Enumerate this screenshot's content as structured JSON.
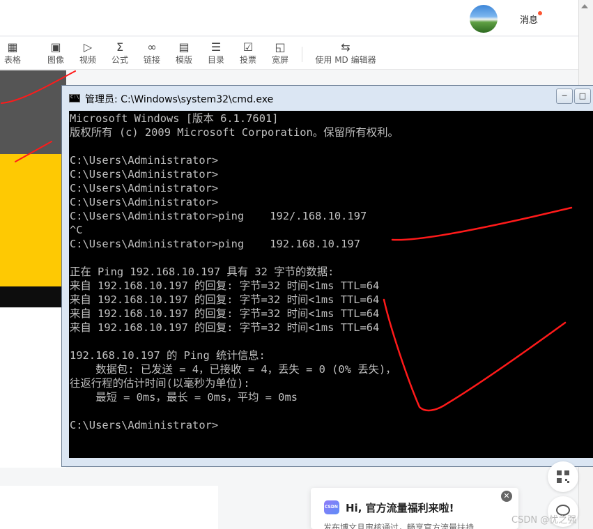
{
  "header": {
    "message_label": "消息",
    "avatar_icon": "user-avatar"
  },
  "toolbar": {
    "items": [
      {
        "label": "表格",
        "icon": "table-icon"
      },
      {
        "label": "图像",
        "icon": "image-icon"
      },
      {
        "label": "视频",
        "icon": "video-icon"
      },
      {
        "label": "公式",
        "icon": "sigma-icon"
      },
      {
        "label": "链接",
        "icon": "link-icon"
      },
      {
        "label": "模版",
        "icon": "template-icon"
      },
      {
        "label": "目录",
        "icon": "list-icon"
      },
      {
        "label": "投票",
        "icon": "vote-icon"
      },
      {
        "label": "宽屏",
        "icon": "fullscreen-icon"
      },
      {
        "label": "使用 MD 编辑器",
        "icon": "switch-icon"
      }
    ]
  },
  "cmd": {
    "title": "管理员: C:\\Windows\\system32\\cmd.exe",
    "lines": [
      "Microsoft Windows [版本 6.1.7601]",
      "版权所有 (c) 2009 Microsoft Corporation。保留所有权利。",
      "",
      "C:\\Users\\Administrator>",
      "C:\\Users\\Administrator>",
      "C:\\Users\\Administrator>",
      "C:\\Users\\Administrator>",
      "C:\\Users\\Administrator>ping    192/.168.10.197",
      "^C",
      "C:\\Users\\Administrator>ping    192.168.10.197",
      "",
      "正在 Ping 192.168.10.197 具有 32 字节的数据:",
      "来自 192.168.10.197 的回复: 字节=32 时间<1ms TTL=64",
      "来自 192.168.10.197 的回复: 字节=32 时间<1ms TTL=64",
      "来自 192.168.10.197 的回复: 字节=32 时间<1ms TTL=64",
      "来自 192.168.10.197 的回复: 字节=32 时间<1ms TTL=64",
      "",
      "192.168.10.197 的 Ping 统计信息:",
      "    数据包: 已发送 = 4，已接收 = 4，丢失 = 0 (0% 丢失)，",
      "往返行程的估计时间(以毫秒为单位):",
      "    最短 = 0ms，最长 = 0ms，平均 = 0ms",
      "",
      "C:\\Users\\Administrator>"
    ]
  },
  "promo": {
    "title": "Hi, 官方流量福利来啦!",
    "subtitle": "发布博文且审核通过，畅享官方流量扶持"
  },
  "watermark": "CSDN @忧之强",
  "colors": {
    "console_bg": "#000000",
    "console_text": "#c0c0c0",
    "annotation": "#ff1a1a",
    "badge": "#fc5531"
  }
}
